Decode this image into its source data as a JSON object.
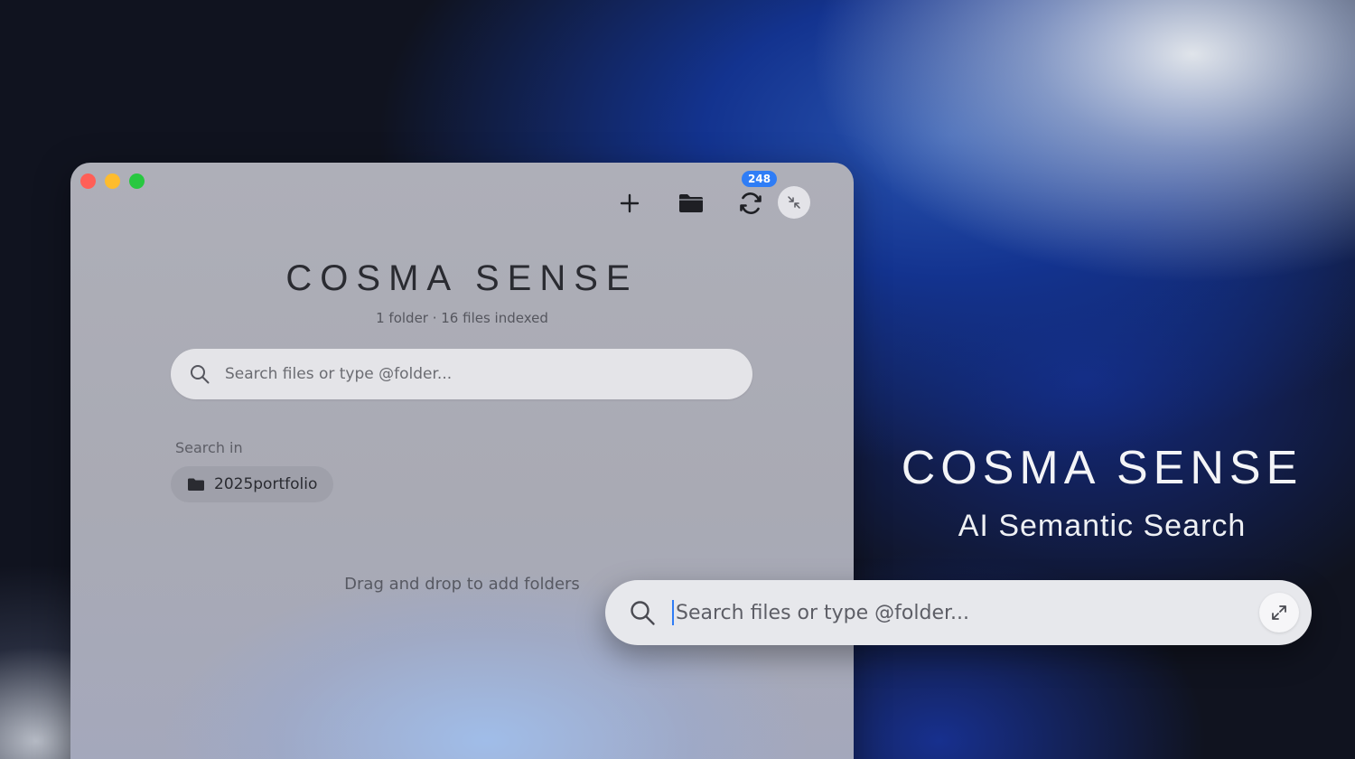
{
  "window": {
    "toolbar": {
      "sync_badge": "248"
    },
    "title": "COSMA SENSE",
    "subtitle": "1 folder · 16 files indexed",
    "search": {
      "placeholder": "Search files or type @folder..."
    },
    "search_in_label": "Search in",
    "folders": [
      {
        "label": "2025portfolio"
      }
    ],
    "drag_hint": "Drag and drop to add folders"
  },
  "brand": {
    "title": "COSMA SENSE",
    "subtitle": "AI Semantic Search"
  },
  "floating_search": {
    "placeholder": "Search files or type @folder..."
  },
  "colors": {
    "accent": "#2f7df6",
    "close": "#ff5f57",
    "minimize": "#febc2e",
    "zoom": "#28c840"
  },
  "icons": {
    "plus": "plus-icon",
    "folder": "folder-icon",
    "sync": "sync-icon",
    "collapse": "collapse-icon",
    "search": "search-icon",
    "expand": "expand-icon"
  }
}
